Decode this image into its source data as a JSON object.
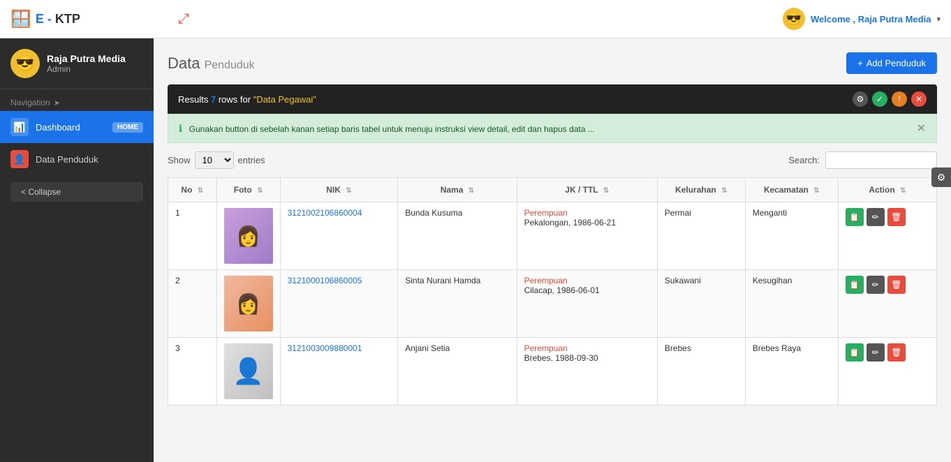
{
  "brand": {
    "icon": "🪟",
    "prefix": "E - ",
    "name": "KTP"
  },
  "topbar": {
    "compress_icon": "⤢",
    "avatar_icon": "😎",
    "welcome_label": "Welcome ,",
    "user_name": "Raja Putra Media",
    "dropdown_arrow": "▾"
  },
  "sidebar": {
    "user": {
      "avatar_icon": "😎",
      "name": "Raja Putra Media",
      "role": "Admin"
    },
    "nav_label": "Navigation",
    "nav_arrow": "➤",
    "items": [
      {
        "id": "dashboard",
        "icon": "📊",
        "label": "Dashboard",
        "badge": "HOME",
        "active": true
      },
      {
        "id": "data-penduduk",
        "icon": "👤",
        "label": "Data Penduduk",
        "badge": "",
        "active": false
      }
    ],
    "collapse_btn": "< Collapse"
  },
  "page": {
    "title": "Data",
    "subtitle": "Penduduk",
    "add_btn_icon": "+",
    "add_btn_label": "Add Penduduk"
  },
  "results_bar": {
    "prefix": "Results",
    "count": "7",
    "mid_text": "rows for",
    "query": "\"Data Pegawai\""
  },
  "info_alert": {
    "icon": "ℹ",
    "text": "Gunakan button di sebelah kanan setiap baris tabel untuk menuju instruksi view detail, edit dan hapus data ..."
  },
  "table_controls": {
    "show_label": "Show",
    "show_value": "10",
    "entries_label": "entries",
    "search_label": "Search:",
    "search_placeholder": ""
  },
  "table": {
    "columns": [
      "No",
      "Foto",
      "NIK",
      "Nama",
      "JK / TTL",
      "Kelurahan",
      "Kecamatan",
      "Action"
    ],
    "rows": [
      {
        "no": "1",
        "foto_type": "lady1",
        "nik": "3121002106860004",
        "nama": "Bunda Kusuma",
        "jk": "Perempuan",
        "ttl": "Pekalongan, 1986-06-21",
        "kelurahan": "Permai",
        "kecamatan": "Menganti"
      },
      {
        "no": "2",
        "foto_type": "lady2",
        "nik": "3121000106860005",
        "nama": "Sinta Nurani Hamda",
        "jk": "Perempuan",
        "ttl": "Cilacap, 1986-06-01",
        "kelurahan": "Sukawani",
        "kecamatan": "Kesugihan"
      },
      {
        "no": "3",
        "foto_type": "silhouette",
        "nik": "3121003009880001",
        "nama": "Anjani Setia",
        "jk": "Perempuan",
        "ttl": "Brebes, 1988-09-30",
        "kelurahan": "Brebes",
        "kecamatan": "Brebes Raya"
      }
    ]
  },
  "action_buttons": {
    "view_icon": "📋",
    "edit_icon": "✏",
    "delete_icon": "🗑"
  }
}
